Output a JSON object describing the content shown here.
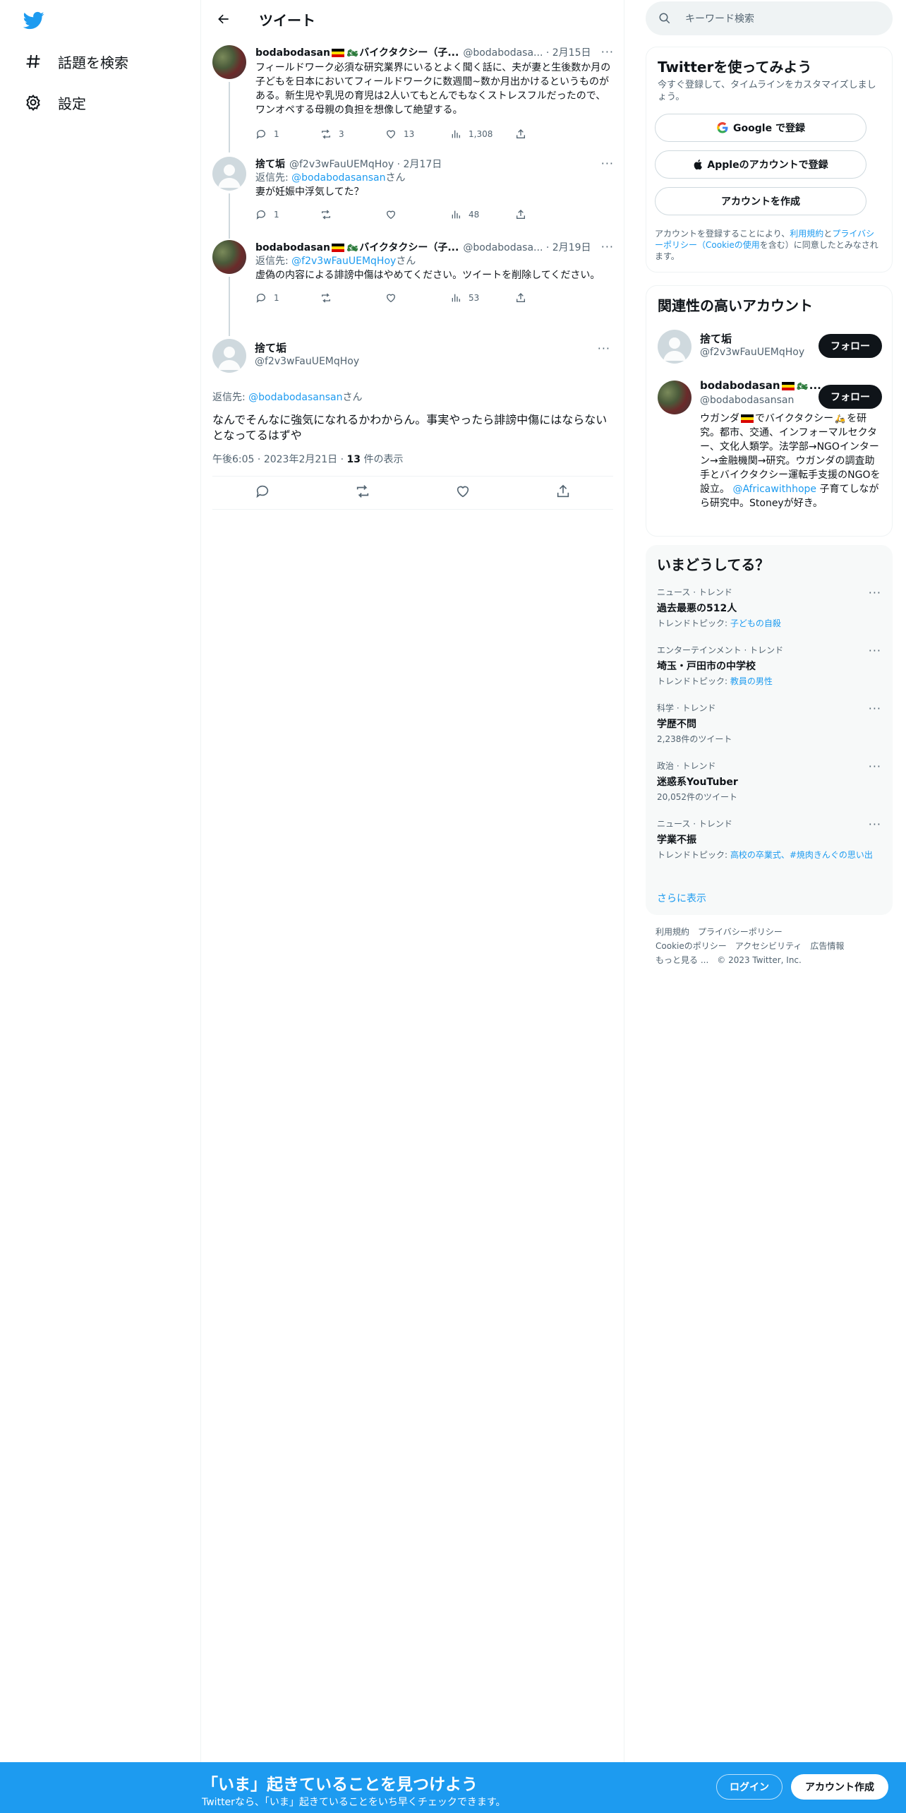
{
  "nav": {
    "explore_label": "話題を検索",
    "settings_label": "設定"
  },
  "header": {
    "title": "ツイート"
  },
  "tweets": [
    {
      "name": "bodabodasan",
      "name_suffix": "バイクタクシー（子...",
      "handle": "@bodabodasa...",
      "date": "2月15日",
      "text": "フィールドワーク必須な研究業界にいるとよく聞く話に、夫が妻と生後数か月の子どもを日本においてフィールドワークに数週間~数か月出かけるというものがある。新生児や乳児の育児は2人いてもとんでもなくストレスフルだったので、ワンオペする母親の負担を想像して絶望する。",
      "replies": "1",
      "retweets": "3",
      "likes": "13",
      "views": "1,308"
    },
    {
      "name": "捨て垢",
      "handle": "@f2v3wFauUEMqHoy",
      "date": "2月17日",
      "reply_prefix": "返信先: ",
      "reply_to": "@bodabodasansan",
      "reply_suffix": "さん",
      "text": "妻が妊娠中浮気してた？",
      "replies": "1",
      "retweets": "",
      "likes": "",
      "views": "48"
    },
    {
      "name": "bodabodasan",
      "name_suffix": "バイクタクシー（子...",
      "handle": "@bodabodasa...",
      "date": "2月19日",
      "reply_prefix": "返信先: ",
      "reply_to": "@f2v3wFauUEMqHoy",
      "reply_suffix": "さん",
      "text": "虚偽の内容による誹謗中傷はやめてください。ツイートを削除してください。",
      "replies": "1",
      "retweets": "",
      "likes": "",
      "views": "53"
    }
  ],
  "main_tweet": {
    "name": "捨て垢",
    "handle": "@f2v3wFauUEMqHoy",
    "reply_prefix": "返信先: ",
    "reply_to": "@bodabodasansan",
    "reply_suffix": "さん",
    "text": "なんでそんなに強気になれるかわからん。事実やったら誹謗中傷にはならないとなってるはずや",
    "time": "午後6:05",
    "date": "2023年2月21日",
    "views_count": "13",
    "views_label": " 件の表示"
  },
  "search": {
    "placeholder": "キーワード検索"
  },
  "signup": {
    "title": "Twitterを使ってみよう",
    "subtitle": "今すぐ登録して、タイムラインをカスタマイズしましょう。",
    "google": "Google で登録",
    "apple": "Appleのアカウントで登録",
    "create": "アカウントを作成",
    "terms_1": "アカウントを登録することにより、",
    "terms_link1": "利用規約",
    "terms_2": "と",
    "terms_link2": "プライバシーポリシー（Cookieの使用",
    "terms_3": "を含む）に同意したとみなされます。"
  },
  "related": {
    "title": "関連性の高いアカウント",
    "follow": "フォロー",
    "accounts": [
      {
        "name": "捨て垢",
        "handle": "@f2v3wFauUEMqHoy"
      },
      {
        "name": "bodabodasan",
        "name_suffix": "...",
        "handle": "@bodabodasansan",
        "bio_1": "ウガンダ",
        "bio_2": "でバイクタクシー",
        "bio_3": "を研究。都市、交通、インフォーマルセクター、文化人類学。法学部→NGOインターン→金融機関→研究。ウガンダの調査助手とバイクタクシー運転手支援のNGOを設立。",
        "bio_link": "@Africawithhope",
        "bio_4": "子育てしながら研究中。Stoneyが好き。"
      }
    ]
  },
  "trends": {
    "title": "いまどうしてる？",
    "items": [
      {
        "category": "ニュース · トレンド",
        "title": "過去最悪の512人",
        "sub_prefix": "トレンドトピック: ",
        "sub_link": "子どもの自殺"
      },
      {
        "category": "エンターテインメント · トレンド",
        "title": "埼玉・戸田市の中学校",
        "sub_prefix": "トレンドトピック: ",
        "sub_link": "教員の男性"
      },
      {
        "category": "科学 · トレンド",
        "title": "学歴不問",
        "sub_text": "2,238件のツイート"
      },
      {
        "category": "政治 · トレンド",
        "title": "迷惑系YouTuber",
        "sub_text": "20,052件のツイート"
      },
      {
        "category": "ニュース · トレンド",
        "title": "学業不振",
        "sub_prefix": "トレンドトピック: ",
        "sub_link": "高校の卒業式、#焼肉きんぐの思い出"
      }
    ],
    "show_more": "さらに表示"
  },
  "footer": {
    "terms": "利用規約",
    "privacy": "プライバシーポリシー",
    "cookie": "Cookieのポリシー",
    "accessibility": "アクセシビリティ",
    "ads": "広告情報",
    "more": "もっと見る ...",
    "copyright": "© 2023 Twitter, Inc."
  },
  "bottom_bar": {
    "title": "「いま」起きていることを見つけよう",
    "subtitle": "Twitterなら、「いま」起きていることをいち早くチェックできます。",
    "login": "ログイン",
    "signup": "アカウント作成"
  },
  "colors": {
    "accent": "#1d9bf0",
    "text": "#0f1419",
    "muted": "#536471"
  }
}
